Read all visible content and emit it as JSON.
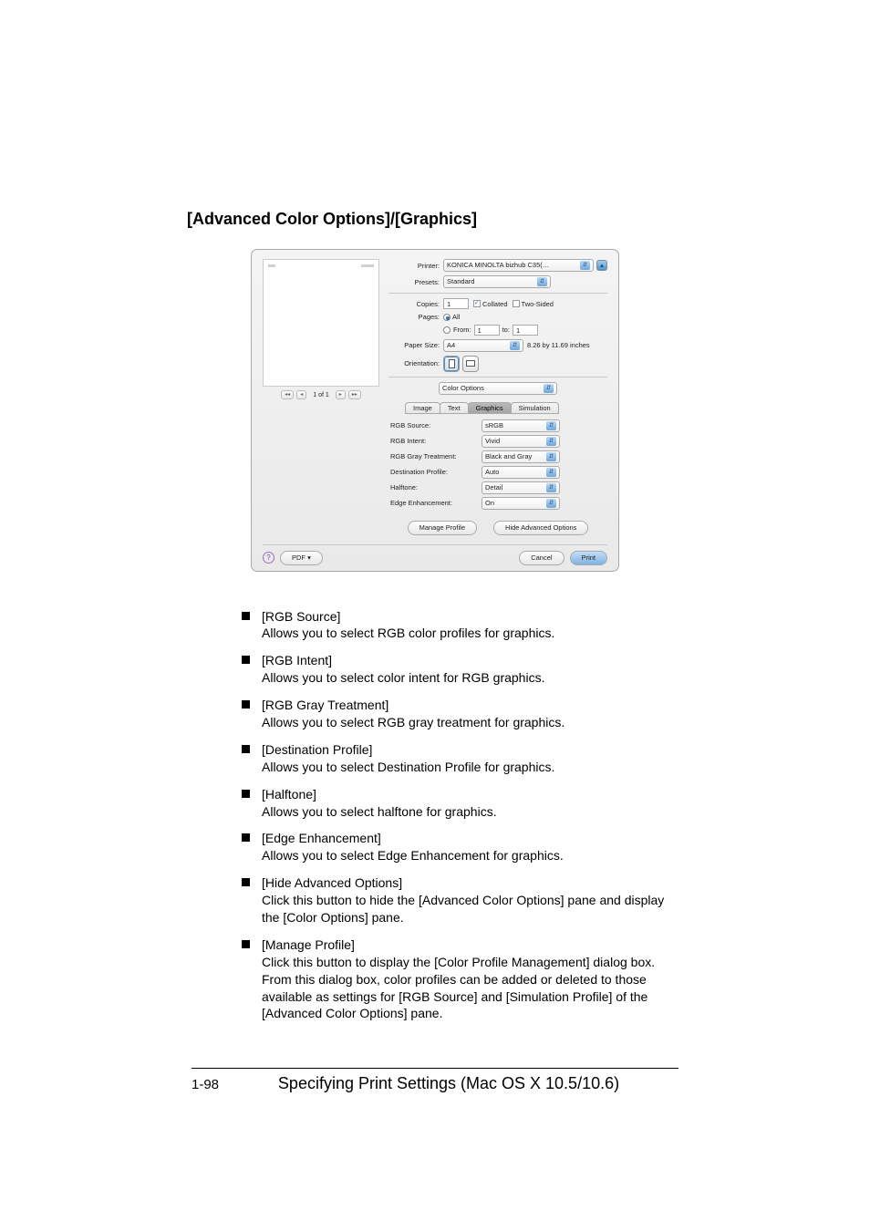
{
  "heading": "[Advanced Color Options]/[Graphics]",
  "dialog": {
    "labels": {
      "printer": "Printer:",
      "presets": "Presets:",
      "copies": "Copies:",
      "pages": "Pages:",
      "from": "From:",
      "to": "to:",
      "paperSize": "Paper Size:",
      "paperDims": "8.26 by 11.69 inches",
      "orientation": "Orientation:"
    },
    "values": {
      "printer": "KONICA MINOLTA bizhub C35(…",
      "presets": "Standard",
      "copies": "1",
      "collated": "Collated",
      "twoSided": "Two-Sided",
      "pagesAll": "All",
      "from": "1",
      "to": "1",
      "paperSize": "A4",
      "pane": "Color Options"
    },
    "preview": {
      "pageOf": "1 of 1",
      "nav_first": "◂◂",
      "nav_prev": "◂",
      "nav_next": "▸",
      "nav_last": "▸▸"
    },
    "tabs": {
      "image": "Image",
      "text": "Text",
      "graphics": "Graphics",
      "simulation": "Simulation"
    },
    "options": {
      "rgbSource": {
        "label": "RGB Source:",
        "value": "sRGB"
      },
      "rgbIntent": {
        "label": "RGB Intent:",
        "value": "Vivid"
      },
      "rgbGray": {
        "label": "RGB Gray Treatment:",
        "value": "Black and Gray"
      },
      "destProfile": {
        "label": "Destination Profile:",
        "value": "Auto"
      },
      "halftone": {
        "label": "Halftone:",
        "value": "Detail"
      },
      "edgeEnhance": {
        "label": "Edge Enhancement:",
        "value": "On"
      }
    },
    "buttons": {
      "manageProfile": "Manage Profile",
      "hideAdvanced": "Hide Advanced Options",
      "pdf": "PDF ▾",
      "cancel": "Cancel",
      "print": "Print"
    }
  },
  "defs": [
    {
      "term": "[RGB Source]",
      "desc": "Allows you to select RGB color profiles for graphics."
    },
    {
      "term": "[RGB Intent]",
      "desc": "Allows you to select color intent for RGB graphics."
    },
    {
      "term": "[RGB Gray Treatment]",
      "desc": "Allows you to select RGB gray treatment for graphics."
    },
    {
      "term": "[Destination Profile]",
      "desc": "Allows you to select Destination Profile for graphics."
    },
    {
      "term": "[Halftone]",
      "desc": "Allows you to select halftone for graphics."
    },
    {
      "term": "[Edge Enhancement]",
      "desc": "Allows you to select Edge Enhancement for graphics."
    },
    {
      "term": "[Hide Advanced Options]",
      "desc": "Click this button to hide the [Advanced Color Options] pane and display the [Color Options] pane."
    },
    {
      "term": "[Manage Profile]",
      "desc": "Click this button to display the [Color Profile Management] dialog box. From this dialog box, color profiles can be added or deleted to those available as settings for [RGB Source] and [Simulation Profile] of the [Advanced Color Options] pane."
    }
  ],
  "footer": {
    "page": "1-98",
    "title": "Specifying Print Settings (Mac OS X 10.5/10.6)"
  }
}
